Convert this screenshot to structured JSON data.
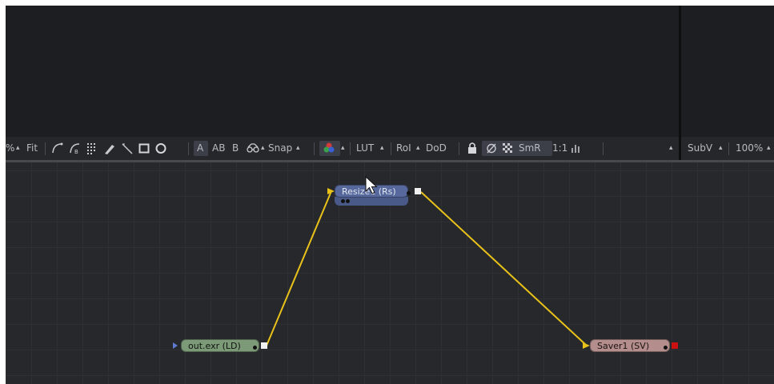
{
  "toolbar": {
    "zoom_left": "%",
    "fit_label": "Fit",
    "a_label": "A",
    "ab_label": "AB",
    "b_label": "B",
    "snap_label": "Snap",
    "lut_label": "LUT",
    "roi_label": "RoI",
    "dod_label": "DoD",
    "smr_label": "SmR",
    "one_to_one_label": "1:1",
    "subv_label": "SubV",
    "zoom_right_label": "100%",
    "dropdown_arrow": "▴"
  },
  "nodes": {
    "loader": {
      "label": "out.exr  (LD)",
      "color": "#7c9a78"
    },
    "resize": {
      "label": "Resize1  (Rs)",
      "color": "#56689c"
    },
    "saver": {
      "label": "Saver1  (SV)",
      "color": "#b38e8c"
    }
  },
  "colors": {
    "link": "#e8c21a",
    "background": "#27282b",
    "toolbar": "#26272b"
  },
  "icons": [
    "bspline-icon",
    "bezier-b-icon",
    "grid-icon",
    "brush-icon",
    "wand-icon",
    "rectangle-icon",
    "circle-icon",
    "stereo-glasses-icon",
    "color-channels-icon",
    "lock-icon",
    "no-entry-icon",
    "checker-icon",
    "histogram-icon",
    "mouse-cursor-icon"
  ]
}
